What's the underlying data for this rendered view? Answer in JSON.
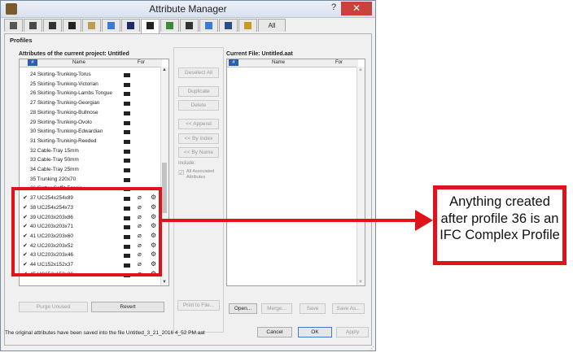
{
  "window": {
    "title": "Attribute Manager",
    "help_label": "?",
    "close_label": "✕"
  },
  "tabs": [
    "pen-icon",
    "layer-icon",
    "line-icon",
    "fill-icon",
    "composite-icon",
    "profile-icon",
    "material-icon",
    "zone-icon",
    "surface-icon",
    "city-icon",
    "building-icon",
    "mep-icon",
    "markup-icon"
  ],
  "tab_all_label": "All",
  "profiles_label": "Profiles",
  "left": {
    "title": "Attributes of the current project: Untitled",
    "col_num": "#",
    "col_name": "Name",
    "col_for": "For",
    "rows": [
      {
        "num": "24",
        "name": "Skirting-Trunking-Torus",
        "checked": false,
        "complex": false
      },
      {
        "num": "25",
        "name": "Skirting-Trunking-Victorian",
        "checked": false,
        "complex": false
      },
      {
        "num": "26",
        "name": "Skirting-Trunking-Lambs Tongue",
        "checked": false,
        "complex": false
      },
      {
        "num": "27",
        "name": "Skirting-Trunking-Georgian",
        "checked": false,
        "complex": false
      },
      {
        "num": "28",
        "name": "Skirting-Trunking-Bullnose",
        "checked": false,
        "complex": false
      },
      {
        "num": "29",
        "name": "Skirting-Trunking-Ovolo",
        "checked": false,
        "complex": false
      },
      {
        "num": "30",
        "name": "Skirting-Trunking-Edwardian",
        "checked": false,
        "complex": false
      },
      {
        "num": "31",
        "name": "Skirting-Trunking-Reeded",
        "checked": false,
        "complex": false
      },
      {
        "num": "32",
        "name": "Cable-Tray 15mm",
        "checked": false,
        "complex": false
      },
      {
        "num": "33",
        "name": "Cable-Tray 50mm",
        "checked": false,
        "complex": false
      },
      {
        "num": "34",
        "name": "Cable-Tray 25mm",
        "checked": false,
        "complex": false
      },
      {
        "num": "35",
        "name": "Trunking 220x70",
        "checked": false,
        "complex": false
      },
      {
        "num": "36",
        "name": "Gutter-Soffit-Fascia",
        "checked": false,
        "complex": false
      },
      {
        "num": "37",
        "name": "UC254x254x89",
        "checked": true,
        "complex": true
      },
      {
        "num": "38",
        "name": "UC254x254x73",
        "checked": true,
        "complex": true
      },
      {
        "num": "39",
        "name": "UC203x203x86",
        "checked": true,
        "complex": true
      },
      {
        "num": "40",
        "name": "UC203x203x71",
        "checked": true,
        "complex": true
      },
      {
        "num": "41",
        "name": "UC203x203x60",
        "checked": true,
        "complex": true
      },
      {
        "num": "42",
        "name": "UC203x203x52",
        "checked": true,
        "complex": true
      },
      {
        "num": "43",
        "name": "UC203x203x46",
        "checked": true,
        "complex": true
      },
      {
        "num": "44",
        "name": "UC152x152x37",
        "checked": true,
        "complex": true
      },
      {
        "num": "45",
        "name": "UC152x152x30",
        "checked": true,
        "complex": true
      }
    ],
    "purge_label": "Purge Unused",
    "revert_label": "Revert"
  },
  "middle": {
    "deselect_all": "Deselect All",
    "duplicate": "Duplicate",
    "delete": "Delete",
    "append": "<< Append",
    "by_index": "<< By Index",
    "by_name": "<< By Name",
    "include_label": "Include:",
    "all_associated": "All Associated Attributes",
    "print_to_file": "Print to File..."
  },
  "right": {
    "title": "Current File: Untitled.aat",
    "col_num": "#",
    "col_name": "Name",
    "col_for": "For",
    "open_label": "Open...",
    "merge_label": "Merge...",
    "save_label": "Save",
    "save_as_label": "Save As..."
  },
  "footer": {
    "status": "The original attributes have been saved into the file Untitled_3_21_2016 4_52 PM.aat",
    "cancel": "Cancel",
    "ok": "OK",
    "apply": "Apply"
  },
  "callout": {
    "text": "Anything  created after profile 36 is an IFC Complex Profile",
    "color": "#e0121b"
  }
}
